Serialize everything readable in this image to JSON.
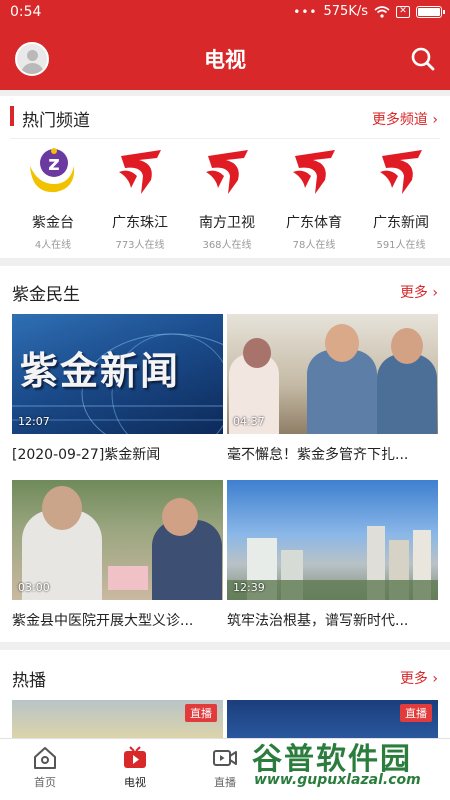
{
  "status": {
    "time": "0:54",
    "dots": "•••",
    "speed": "575K/s",
    "battery_level": 0.9
  },
  "header": {
    "title": "电视"
  },
  "hot": {
    "title": "热门频道",
    "more": "更多频道 ›",
    "channels": [
      {
        "name": "紫金台",
        "count": "4人在线",
        "logo": "zijin-logo"
      },
      {
        "name": "广东珠江",
        "count": "773人在线",
        "logo": "gdtv-logo"
      },
      {
        "name": "南方卫视",
        "count": "368人在线",
        "logo": "gdtv-logo"
      },
      {
        "name": "广东体育",
        "count": "78人在线",
        "logo": "gdtv-logo"
      },
      {
        "name": "广东新闻",
        "count": "591人在线",
        "logo": "gdtv-logo"
      }
    ]
  },
  "minsheng": {
    "title": "紫金民生",
    "more": "更多 ›",
    "videos": [
      {
        "title": "[2020-09-27]紫金新闻",
        "duration": "12:07",
        "thumb_text": "紫金新闻"
      },
      {
        "title": "毫不懈怠！紫金多管齐下扎...",
        "duration": "04:37"
      },
      {
        "title": "紫金县中医院开展大型义诊...",
        "duration": "03:00"
      },
      {
        "title": "筑牢法治根基，谱写新时代...",
        "duration": "12:39"
      }
    ]
  },
  "live": {
    "title": "热播",
    "more": "更多 ›",
    "badge": "直播"
  },
  "tabs": [
    {
      "label": "首页",
      "icon": "home-icon"
    },
    {
      "label": "电视",
      "icon": "tv-icon"
    },
    {
      "label": "直播",
      "icon": "video-icon"
    }
  ],
  "watermark": {
    "big": "谷普软件园",
    "small": "www.gupuxlazal.com"
  }
}
